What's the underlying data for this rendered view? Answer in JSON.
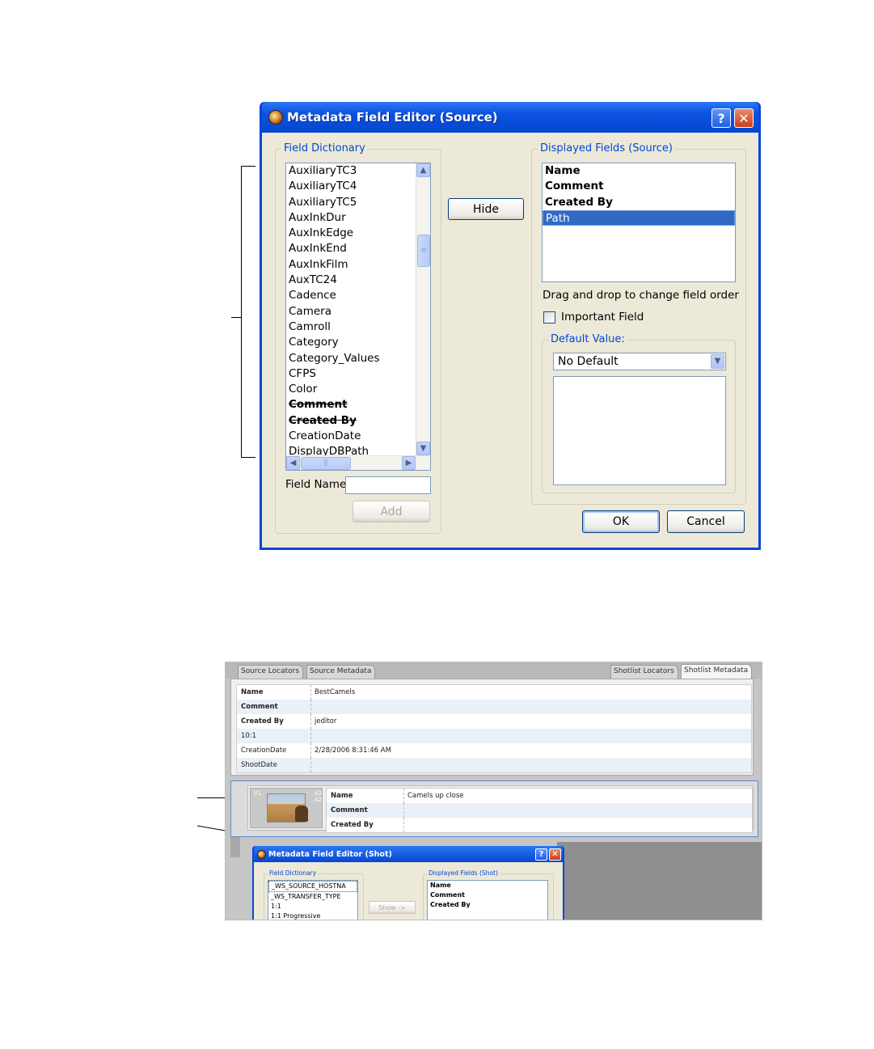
{
  "dialog": {
    "title": "Metadata Field Editor (Source)",
    "help_label": "?",
    "close_label": "✕",
    "field_dictionary": {
      "label": "Field Dictionary",
      "items": [
        {
          "label": "AuxiliaryTC3",
          "style": "normal"
        },
        {
          "label": "AuxiliaryTC4",
          "style": "normal"
        },
        {
          "label": "AuxiliaryTC5",
          "style": "normal"
        },
        {
          "label": "AuxInkDur",
          "style": "normal"
        },
        {
          "label": "AuxInkEdge",
          "style": "normal"
        },
        {
          "label": "AuxInkEnd",
          "style": "normal"
        },
        {
          "label": "AuxInkFilm",
          "style": "normal"
        },
        {
          "label": "AuxTC24",
          "style": "normal"
        },
        {
          "label": "Cadence",
          "style": "normal"
        },
        {
          "label": "Camera",
          "style": "normal"
        },
        {
          "label": "Camroll",
          "style": "normal"
        },
        {
          "label": "Category",
          "style": "normal"
        },
        {
          "label": "Category_Values",
          "style": "normal"
        },
        {
          "label": "CFPS",
          "style": "normal"
        },
        {
          "label": "Color",
          "style": "normal"
        },
        {
          "label": "Comment",
          "style": "strike"
        },
        {
          "label": "Created By",
          "style": "strike"
        },
        {
          "label": "CreationDate",
          "style": "normal"
        },
        {
          "label": "DisplayDBPath",
          "style": "normal"
        }
      ],
      "field_name_label": "Field Name:",
      "field_name_value": "",
      "add_label": "Add"
    },
    "hide_label": "Hide",
    "displayed_fields": {
      "label": "Displayed Fields (Source)",
      "items": [
        {
          "label": "Name",
          "selected": false
        },
        {
          "label": "Comment",
          "selected": false
        },
        {
          "label": "Created By",
          "selected": false
        },
        {
          "label": "Path",
          "selected": true
        }
      ],
      "drag_hint": "Drag and drop to change field order",
      "important_label": "Important Field",
      "important_checked": false,
      "default_value": {
        "label": "Default Value:",
        "selected": "No Default"
      }
    },
    "ok_label": "OK",
    "cancel_label": "Cancel"
  },
  "screenshot2": {
    "tabs": [
      "Source Locators",
      "Source Metadata",
      "Shotlist Locators",
      "Shotlist Metadata"
    ],
    "active_tab": "Shotlist Metadata",
    "metadata_rows": [
      {
        "key": "Name",
        "value": "BestCamels",
        "bold": true
      },
      {
        "key": "Comment",
        "value": "",
        "bold": true
      },
      {
        "key": "Created By",
        "value": "jeditor",
        "bold": true
      },
      {
        "key": "10:1",
        "value": "",
        "bold": false
      },
      {
        "key": "CreationDate",
        "value": "2/28/2006 8:31:46 AM",
        "bold": false
      },
      {
        "key": "ShootDate",
        "value": "",
        "bold": false
      }
    ],
    "clip": {
      "track_video": "V1",
      "track_audio_1": "A1",
      "track_audio_2": "A2",
      "rows": [
        {
          "key": "Name",
          "value": "Camels up close"
        },
        {
          "key": "Comment",
          "value": ""
        },
        {
          "key": "Created By",
          "value": ""
        }
      ]
    },
    "shot_dialog": {
      "title": "Metadata Field Editor (Shot)",
      "help_label": "?",
      "close_label": "✕",
      "field_dictionary_label": "Field Dictionary",
      "dictionary_items": [
        "_WS_SOURCE_HOSTNA",
        "_WS_TRANSFER_TYPE",
        "1:1",
        "1:1 Progressive"
      ],
      "show_label": "Show ->",
      "displayed_fields_label": "Displayed Fields (Shot)",
      "displayed_items": [
        "Name",
        "Comment",
        "Created By"
      ]
    }
  }
}
